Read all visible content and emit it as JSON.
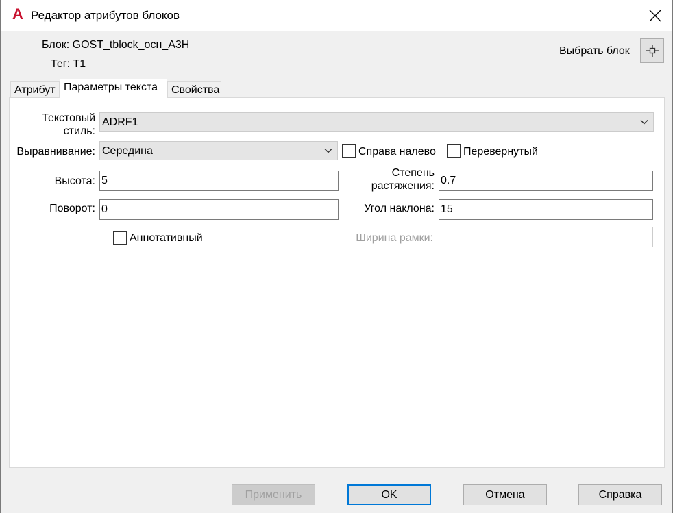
{
  "window": {
    "title": "Редактор атрибутов блоков",
    "app_icon_glyph": "A",
    "app_icon_color": "#c8102e",
    "close_icon": "close-icon"
  },
  "info": {
    "block_label": "Блок: GOST_tblock_осн_A3H",
    "tag_label": "Тег: T1",
    "pick_block_label": "Выбрать блок",
    "pick_icon": "crosshair-icon"
  },
  "tabs": [
    {
      "label": "Атрибут",
      "active": false
    },
    {
      "label": "Параметры текста",
      "active": true
    },
    {
      "label": "Свойства",
      "active": false
    }
  ],
  "form": {
    "text_style": {
      "label_line1": "Текстовый",
      "label_line2": "стиль:",
      "value": "ADRF1"
    },
    "alignment": {
      "label": "Выравнивание:",
      "value": "Середина"
    },
    "right_to_left": {
      "label": "Справа налево",
      "checked": false
    },
    "upside_down": {
      "label": "Перевернутый",
      "checked": false
    },
    "height": {
      "label": "Высота:",
      "value": "5"
    },
    "width_factor": {
      "label_line1": "Степень",
      "label_line2": "растяжения:",
      "value": "0.7"
    },
    "rotation": {
      "label": "Поворот:",
      "value": "0"
    },
    "oblique_angle": {
      "label": "Угол наклона:",
      "value": "15"
    },
    "annotative": {
      "label": "Аннотативный",
      "checked": false
    },
    "frame_width": {
      "label": "Ширина рамки:",
      "value": ""
    }
  },
  "buttons": {
    "apply": "Применить",
    "ok": "OK",
    "cancel": "Отмена",
    "help": "Справка"
  },
  "colors": {
    "accent": "#0078d7",
    "dialog_bg": "#f0f0f0",
    "panel_bg": "#ffffff",
    "disabled_text": "#a0a0a0"
  }
}
